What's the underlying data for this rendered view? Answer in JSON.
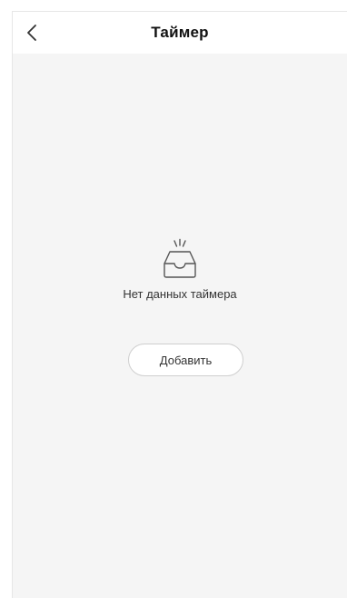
{
  "header": {
    "title": "Таймер",
    "back_icon": "chevron-left-icon"
  },
  "empty_state": {
    "icon": "empty-inbox-icon",
    "message": "Нет данных таймера"
  },
  "actions": {
    "add_label": "Добавить"
  },
  "colors": {
    "background": "#f5f5f5",
    "header_background": "#ffffff",
    "text": "#333333",
    "icon_stroke": "#555555",
    "button_border": "#cfcfcf"
  }
}
